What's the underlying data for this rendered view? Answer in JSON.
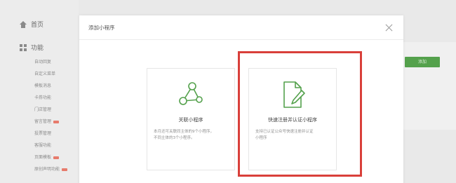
{
  "sidebar": {
    "home_label": "首页",
    "features_label": "功能",
    "sub_items": [
      {
        "label": "自动回复",
        "badge": false
      },
      {
        "label": "自定义菜单",
        "badge": false
      },
      {
        "label": "模板消息",
        "badge": false
      },
      {
        "label": "卡券功能",
        "badge": false
      },
      {
        "label": "门店管理",
        "badge": false
      },
      {
        "label": "留言管理",
        "badge": true
      },
      {
        "label": "投票管理",
        "badge": false
      },
      {
        "label": "客服功能",
        "badge": false
      },
      {
        "label": "页面模板",
        "badge": true
      },
      {
        "label": "原创声明功能",
        "badge": true
      }
    ]
  },
  "background": {
    "add_button_label": "添加"
  },
  "modal": {
    "title": "添加小程序",
    "options": [
      {
        "title": "关联小程序",
        "description": "本月还可关联同主体的9个小程序，\n不同主体的3个小程序。",
        "icon": "share-nodes-icon"
      },
      {
        "title": "快速注册并认证小程序",
        "description": "支持已认证公众号快速注册并认证\n小程序",
        "icon": "document-edit-icon"
      }
    ]
  },
  "colors": {
    "accent_green": "#54a14c",
    "highlight_red": "#d93f3a",
    "badge_red": "#e77b6c"
  }
}
